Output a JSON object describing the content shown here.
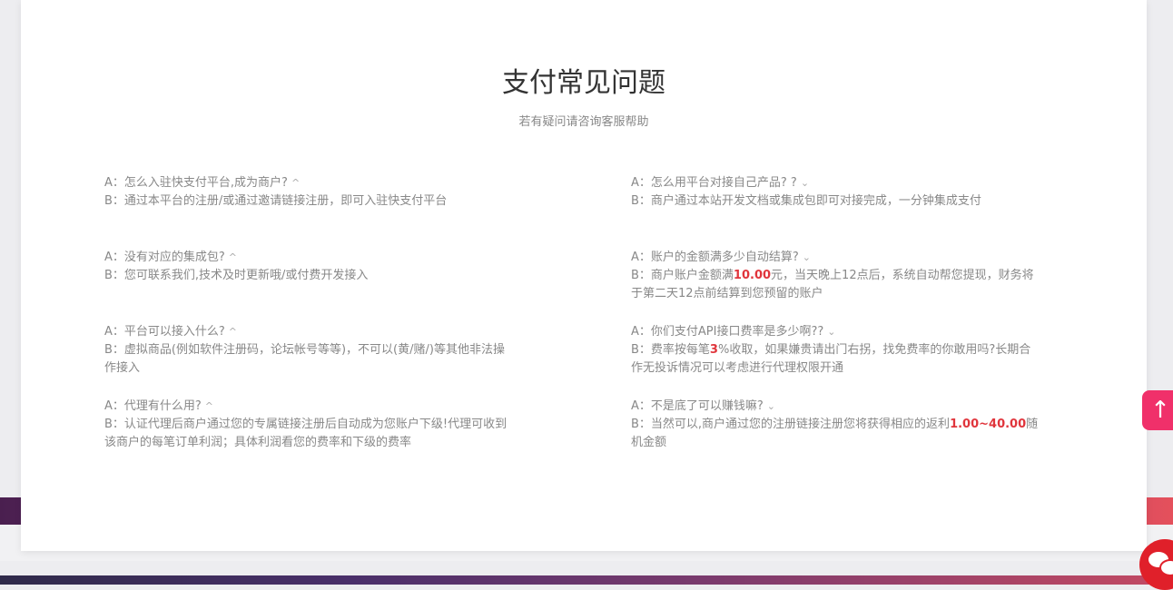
{
  "header": {
    "title": "支付常见问题",
    "subtitle": "若有疑问请咨询客服帮助"
  },
  "faq_left": [
    {
      "q": "A：怎么入驻快支付平台,成为商户?",
      "caret": "^",
      "a": "B：通过本平台的注册/或通过邀请链接注册，即可入驻快支付平台"
    },
    {
      "q": "A：没有对应的集成包?",
      "caret": "^",
      "a": "B：您可联系我们,技术及时更新哦/或付费开发接入"
    },
    {
      "q": "A：平台可以接入什么?",
      "caret": "^",
      "a": "B：虚拟商品(例如软件注册码，论坛帐号等等)，不可以(黄/赌/)等其他非法操作接入"
    },
    {
      "q": "A：代理有什么用?",
      "caret": "^",
      "a": "B：认证代理后商户通过您的专属链接注册后自动成为您账户下级!代理可收到该商户的每笔订单利润；具体利润看您的费率和下级的费率"
    }
  ],
  "faq_right": [
    {
      "q": "A：怎么用平台对接自己产品? ?",
      "caret": "⌄",
      "a": "B：商户通过本站开发文档或集成包即可对接完成，一分钟集成支付"
    },
    {
      "q": "A：账户的金额满多少自动结算?",
      "caret": "⌄",
      "a_pre": "B：商户账户金额满",
      "a_hl": "10.00",
      "a_post": "元，当天晚上12点后，系统自动帮您提现，财务将于第二天12点前结算到您预留的账户"
    },
    {
      "q": "A：你们支付API接口费率是多少啊??",
      "caret": "⌄",
      "a_pre": "B：费率按每笔",
      "a_hl": "3",
      "a_post": "%收取，如果嫌贵请出门右拐，找免费率的你敢用吗?长期合作无投诉情况可以考虑进行代理权限开通"
    },
    {
      "q": "A：不是底了可以赚钱嘛?",
      "caret": "⌄",
      "a_pre": "B：当然可以,商户通过您的注册链接注册您将获得相应的返利",
      "a_hl": "1.00~40.00",
      "a_post": "随机金额"
    }
  ],
  "buttons": {
    "back_to_top": "↑",
    "icons": {
      "back_to_top": "arrow-up-icon",
      "chat": "chat-bubble-icon"
    }
  },
  "colors": {
    "highlight": "#e0353c",
    "accent": "#f0306a",
    "chat": "#e0202a"
  }
}
